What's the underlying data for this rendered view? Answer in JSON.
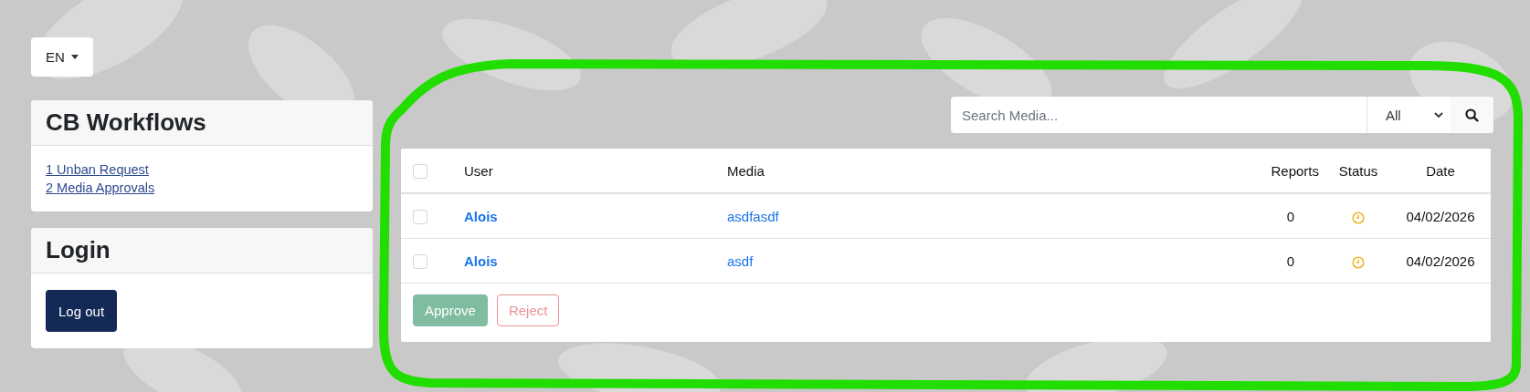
{
  "language_button": {
    "label": "EN"
  },
  "workflows_card": {
    "title": "CB Workflows",
    "links": [
      "1 Unban Request",
      "2 Media Approvals"
    ]
  },
  "login_card": {
    "title": "Login",
    "button": "Log out"
  },
  "search": {
    "placeholder": "Search Media...",
    "filter": "All"
  },
  "table": {
    "select_all": {
      "checked": false
    },
    "columns": [
      "User",
      "Media",
      "Reports",
      "Status",
      "Date"
    ],
    "rows": [
      {
        "selected": false,
        "user": "Alois",
        "media": "asdfasdf",
        "reports": "0",
        "color": "#f0b429",
        "date": "04/02/2026"
      },
      {
        "selected": false,
        "user": "Alois",
        "media": "asdf",
        "reports": "0",
        "color": "#f0b429",
        "date": "04/02/2026"
      }
    ]
  },
  "actions": [
    {
      "label": "Approve",
      "kind": "approve",
      "disabled": true
    },
    {
      "label": "Reject",
      "kind": "reject",
      "disabled": true
    }
  ]
}
